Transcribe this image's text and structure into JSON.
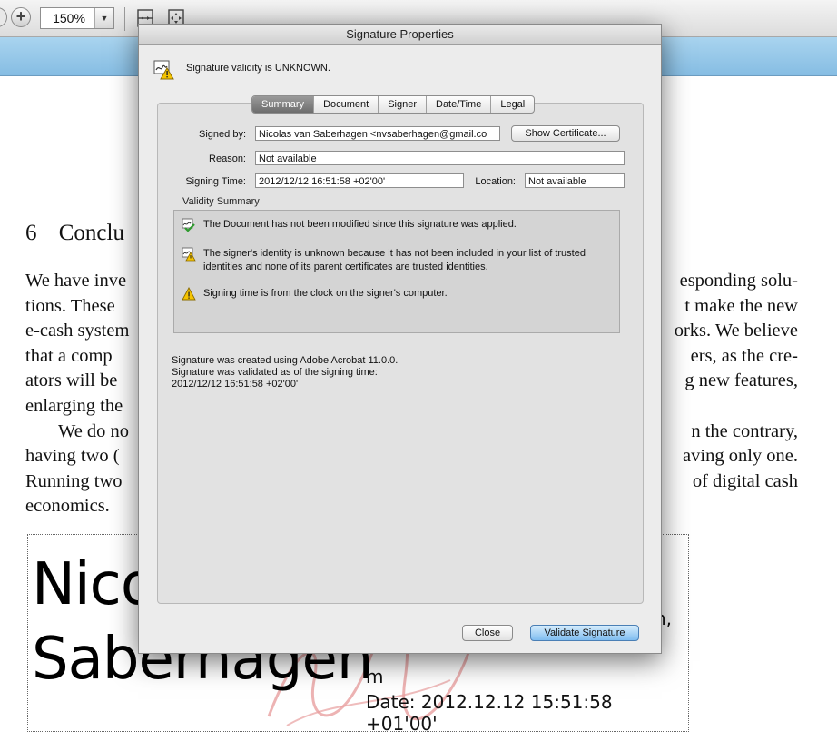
{
  "toolbar": {
    "zoom_value": "150%",
    "zoom_dropdown": "▼"
  },
  "document": {
    "heading_number": "6",
    "heading_text": "Conclu",
    "para1": [
      {
        "left": "We have inve",
        "right": "esponding solu-"
      },
      {
        "left": "tions. These",
        "right": "t make the new"
      },
      {
        "left": "e-cash system",
        "right": "orks. We believe"
      },
      {
        "left": "that a comp",
        "right": "ers, as the cre-"
      },
      {
        "left": "ators will be",
        "right": "g new features,"
      },
      {
        "left": "enlarging the",
        "right": ""
      }
    ],
    "para2": [
      {
        "left": "We do no",
        "right": "n the contrary,"
      },
      {
        "left": "having two (",
        "right": "aving only one."
      },
      {
        "left": "Running two",
        "right": "of digital cash"
      },
      {
        "left": "economics.",
        "right": ""
      }
    ]
  },
  "signature_box": {
    "name_line1": "Nico",
    "name_line2": "Saberhagen",
    "right_fragment1": "n,",
    "right_fragment2": "m",
    "date": "Date: 2012.12.12 15:51:58 +01'00'"
  },
  "dialog": {
    "title": "Signature Properties",
    "status": "Signature validity is UNKNOWN.",
    "tabs": [
      {
        "label": "Summary",
        "active": true
      },
      {
        "label": "Document",
        "active": false
      },
      {
        "label": "Signer",
        "active": false
      },
      {
        "label": "Date/Time",
        "active": false
      },
      {
        "label": "Legal",
        "active": false
      }
    ],
    "signed_by_label": "Signed by:",
    "signed_by_value": "Nicolas van Saberhagen <nvsaberhagen@gmail.co",
    "show_certificate": "Show Certificate...",
    "reason_label": "Reason:",
    "reason_value": "Not available",
    "signing_time_label": "Signing Time:",
    "signing_time_value": "2012/12/12 16:51:58 +02'00'",
    "location_label": "Location:",
    "location_value": "Not available",
    "validity_summary_title": "Validity Summary",
    "validity_items": [
      {
        "icon": "document-ok-icon",
        "text": "The Document has not been modified since this signature was applied."
      },
      {
        "icon": "identity-warning-icon",
        "text": "The signer's identity is unknown because it has not been included in your list of trusted identities and none of its parent certificates are trusted identities."
      },
      {
        "icon": "warning-icon",
        "text": "Signing time is from the clock on the signer's computer."
      }
    ],
    "info_line1": "Signature was created using Adobe Acrobat 11.0.0.",
    "info_line2": "Signature was validated as of the signing time:",
    "info_line3": "2012/12/12 16:51:58 +02'00'",
    "close_button": "Close",
    "validate_button": "Validate Signature"
  }
}
